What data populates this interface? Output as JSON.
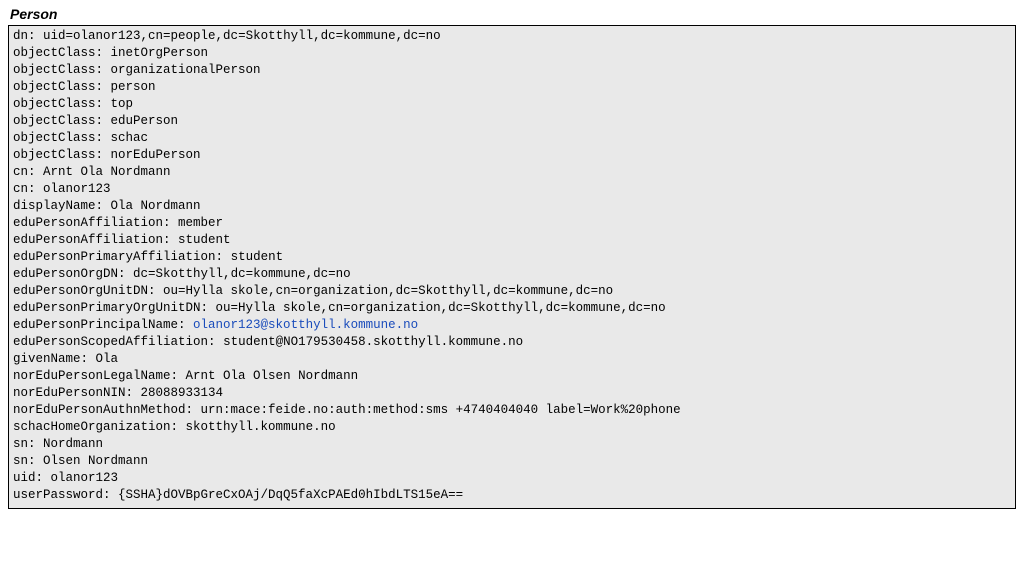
{
  "heading": "Person",
  "entries": [
    {
      "key": "dn",
      "value": "uid=olanor123,cn=people,dc=Skotthyll,dc=kommune,dc=no"
    },
    {
      "key": "objectClass",
      "value": "inetOrgPerson"
    },
    {
      "key": "objectClass",
      "value": "organizationalPerson"
    },
    {
      "key": "objectClass",
      "value": "person"
    },
    {
      "key": "objectClass",
      "value": "top"
    },
    {
      "key": "objectClass",
      "value": "eduPerson"
    },
    {
      "key": "objectClass",
      "value": "schac"
    },
    {
      "key": "objectClass",
      "value": "norEduPerson"
    },
    {
      "key": "cn",
      "value": "Arnt Ola Nordmann"
    },
    {
      "key": "cn",
      "value": "olanor123"
    },
    {
      "key": "displayName",
      "value": "Ola Nordmann"
    },
    {
      "key": "eduPersonAffiliation",
      "value": "member"
    },
    {
      "key": "eduPersonAffiliation",
      "value": "student"
    },
    {
      "key": "eduPersonPrimaryAffiliation",
      "value": "student"
    },
    {
      "key": "eduPersonOrgDN",
      "value": "dc=Skotthyll,dc=kommune,dc=no"
    },
    {
      "key": "eduPersonOrgUnitDN",
      "value": "ou=Hylla skole,cn=organization,dc=Skotthyll,dc=kommune,dc=no"
    },
    {
      "key": "eduPersonPrimaryOrgUnitDN",
      "value": "ou=Hylla skole,cn=organization,dc=Skotthyll,dc=kommune,dc=no"
    },
    {
      "key": "eduPersonPrincipalName",
      "value": "olanor123@skotthyll.kommune.no",
      "link": true
    },
    {
      "key": "eduPersonScopedAffiliation",
      "value": "student@NO179530458.skotthyll.kommune.no"
    },
    {
      "key": "givenName",
      "value": "Ola"
    },
    {
      "key": "norEduPersonLegalName",
      "value": "Arnt Ola Olsen Nordmann"
    },
    {
      "key": "norEduPersonNIN",
      "value": "28088933134"
    },
    {
      "key": "norEduPersonAuthnMethod",
      "value": "urn:mace:feide.no:auth:method:sms +4740404040 label=Work%20phone"
    },
    {
      "key": "schacHomeOrganization",
      "value": "skotthyll.kommune.no"
    },
    {
      "key": "sn",
      "value": "Nordmann"
    },
    {
      "key": "sn",
      "value": "Olsen Nordmann"
    },
    {
      "key": "uid",
      "value": "olanor123"
    },
    {
      "key": "userPassword",
      "value": "{SSHA}dOVBpGreCxOAj/DqQ5faXcPAEd0hIbdLTS15eA=="
    }
  ]
}
